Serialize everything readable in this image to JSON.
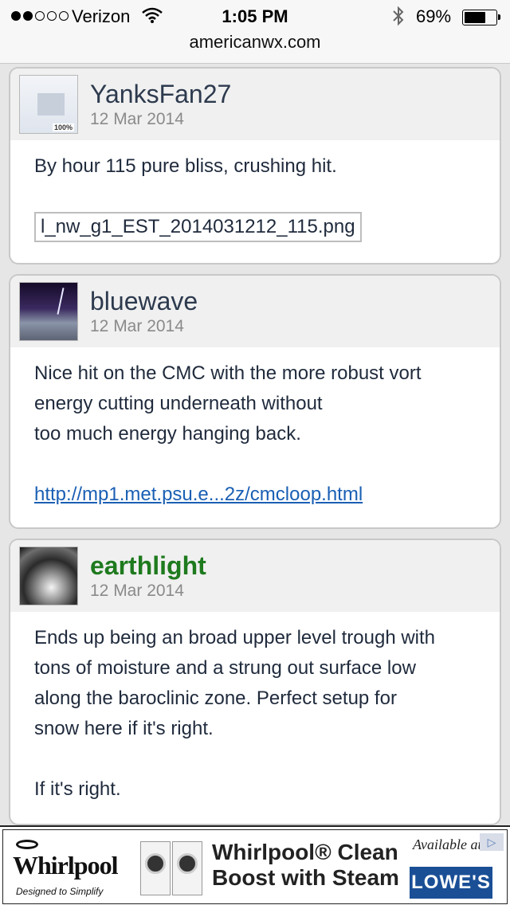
{
  "status": {
    "carrier": "Verizon",
    "time": "1:05 PM",
    "battery": "69%",
    "battery_level": 0.69,
    "url": "americanwx.com"
  },
  "posts": [
    {
      "username": "YanksFan27",
      "date": "12 Mar 2014",
      "avatar_label": "100%",
      "body": [
        "By hour 115 pure bliss, crushing hit."
      ],
      "attachment": "l_nw_g1_EST_2014031212_115.png"
    },
    {
      "username": "bluewave",
      "date": "12 Mar 2014",
      "body": [
        "Nice hit on the CMC with the more robust vort",
        "energy cutting underneath without",
        "too much energy hanging back."
      ],
      "link": "http://mp1.met.psu.e...2z/cmcloop.html"
    },
    {
      "username": "earthlight",
      "date": "12 Mar 2014",
      "username_color": "#1e7a1e",
      "body": [
        "Ends up being an broad upper level trough with",
        "tons of moisture and a strung out surface low",
        "along the baroclinic zone. Perfect setup for",
        "snow here if it's right."
      ],
      "body2": "If it's right."
    }
  ],
  "ad": {
    "brand": "Whirlpool",
    "brand_mark": "®",
    "tagline": "Designed to Simplify",
    "headline_1": "Whirlpool® Clean",
    "headline_2": "Boost with Steam",
    "available_at": "Available at",
    "retailer": "LOWE'S"
  }
}
